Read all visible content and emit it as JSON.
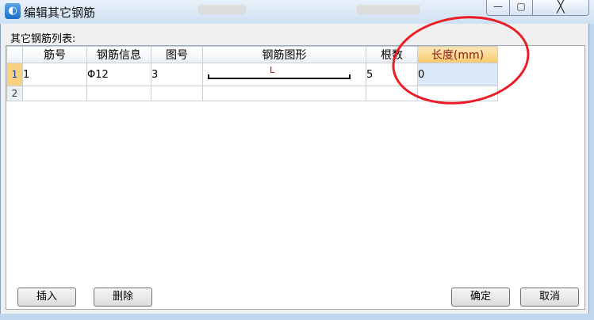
{
  "window": {
    "title": "编辑其它钢筋",
    "icon": "app-logo-icon",
    "close_glyph": "╳",
    "min_glyph": "—",
    "max_glyph": "▢"
  },
  "list_label": "其它钢筋列表:",
  "columns": [
    "筋号",
    "钢筋信息",
    "图号",
    "钢筋图形",
    "根数",
    "长度(mm)"
  ],
  "rows": [
    {
      "num": "1",
      "jinhao": "1",
      "info": "Φ12",
      "tuhao": "3",
      "shape_label": "L",
      "genshu": "5",
      "length": "0"
    },
    {
      "num": "2",
      "jinhao": "",
      "info": "",
      "tuhao": "",
      "shape_label": "",
      "genshu": "",
      "length": ""
    }
  ],
  "buttons": {
    "insert": "插入",
    "delete": "删除",
    "ok": "确定",
    "cancel": "取消"
  },
  "colors": {
    "annotation_circle": "#ec1c24",
    "active_header": "#f6c96d"
  }
}
